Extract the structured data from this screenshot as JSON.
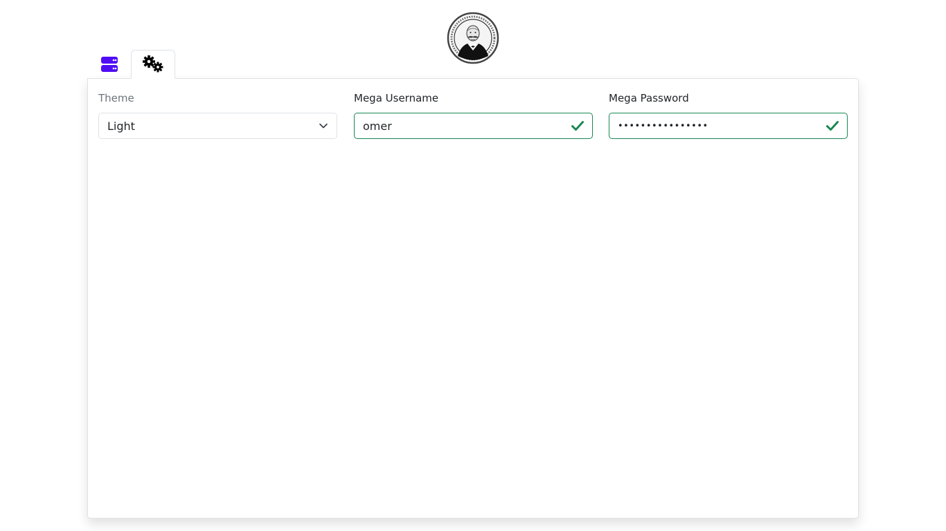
{
  "header": {
    "logo_icon": "mustached-gentleman-portrait-logo"
  },
  "tabs": [
    {
      "icon": "server-icon",
      "active": false,
      "color": "#4f0cf5"
    },
    {
      "icon": "gears-icon",
      "active": true,
      "color": "#000000"
    }
  ],
  "settings": {
    "theme": {
      "label": "Theme",
      "value": "Light"
    },
    "mega_username": {
      "label": "Mega Username",
      "value": "omer",
      "valid": true
    },
    "mega_password": {
      "label": "Mega Password",
      "masked_value": "••••••••••••••••",
      "valid": true
    }
  },
  "colors": {
    "accent": "#4f0cf5",
    "valid": "#198754",
    "border": "#dee2e6"
  }
}
